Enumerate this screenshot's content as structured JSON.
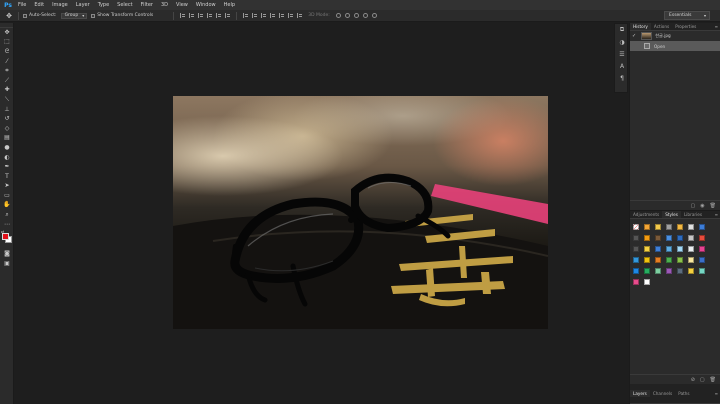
{
  "app": {
    "logo": "Ps"
  },
  "menu": [
    "File",
    "Edit",
    "Image",
    "Layer",
    "Type",
    "Select",
    "Filter",
    "3D",
    "View",
    "Window",
    "Help"
  ],
  "options": {
    "auto_select_label": "Auto-Select:",
    "auto_select_target": "Group",
    "show_transform_label": "Show Transform Controls",
    "mode_3d_label": "3D Mode:"
  },
  "workspace": {
    "selected": "Essentials"
  },
  "history_panel": {
    "tabs": [
      "History",
      "Actions",
      "Properties"
    ],
    "snapshot_name": "한글.jpg",
    "states": [
      "Open"
    ]
  },
  "styles_panel": {
    "tabs": [
      "Adjustments",
      "Styles",
      "Libraries"
    ],
    "swatches": [
      "#ffffff",
      "#f4a636",
      "#f2c94c",
      "#a0a0a0",
      "#f4b942",
      "#e0e0e0",
      "#3d7dd8",
      "#555555",
      "#f39c12",
      "#7a5a3a",
      "#4a90e2",
      "#2d6cc0",
      "#c6c6c6",
      "#e74c3c",
      "#555555",
      "#f5d142",
      "#3f7fd6",
      "#5dade2",
      "#a2d9f7",
      "#ecf0f1",
      "#e84393",
      "#3498db",
      "#f1c40f",
      "#e67e22",
      "#4caf50",
      "#8bc34a",
      "#f9e79f",
      "#3b6fc9",
      "#1e88e5",
      "#27ae60",
      "#7dcea0",
      "#9b59b6",
      "#5d6d7e",
      "#f4d03f",
      "#76d7c4",
      "#e74c8c",
      "#ffffff"
    ]
  },
  "layers_panel": {
    "tabs": [
      "Layers",
      "Channels",
      "Paths"
    ]
  },
  "colors": {
    "foreground": "#e0101a",
    "background": "#ffffff"
  }
}
